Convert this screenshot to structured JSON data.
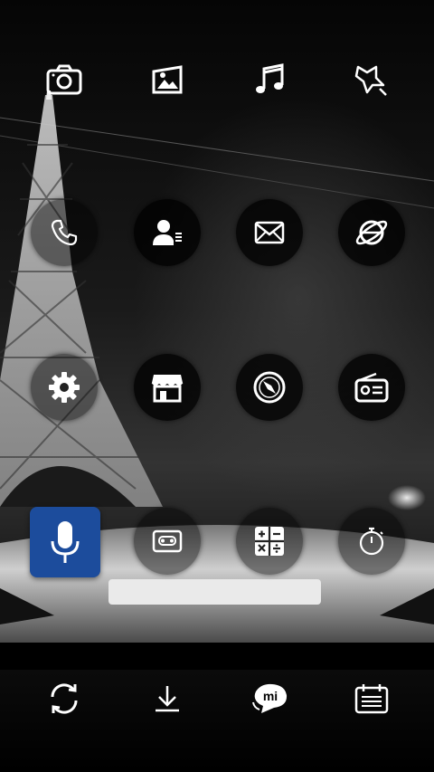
{
  "wallpaper": {
    "description_icon": "eiffel-tower-night-car"
  },
  "rows": [
    {
      "icons": [
        {
          "name": "camera-icon"
        },
        {
          "name": "gallery-icon"
        },
        {
          "name": "music-icon"
        },
        {
          "name": "themes-icon"
        }
      ]
    },
    {
      "icons": [
        {
          "name": "phone-icon"
        },
        {
          "name": "contacts-icon"
        },
        {
          "name": "messages-icon"
        },
        {
          "name": "browser-icon"
        }
      ]
    },
    {
      "icons": [
        {
          "name": "settings-icon"
        },
        {
          "name": "store-icon"
        },
        {
          "name": "compass-icon"
        },
        {
          "name": "radio-icon"
        }
      ]
    },
    {
      "icons": [
        {
          "name": "voice-recorder-icon"
        },
        {
          "name": "cassette-icon"
        },
        {
          "name": "calculator-icon"
        },
        {
          "name": "stopwatch-icon"
        }
      ]
    }
  ],
  "dock": {
    "icons": [
      {
        "name": "sync-icon"
      },
      {
        "name": "download-icon"
      },
      {
        "name": "mi-talk-icon",
        "text": "mi"
      },
      {
        "name": "calendar-icon"
      }
    ]
  },
  "colors": {
    "accent_tile": "#1c4c9c",
    "icon": "#ffffff"
  }
}
